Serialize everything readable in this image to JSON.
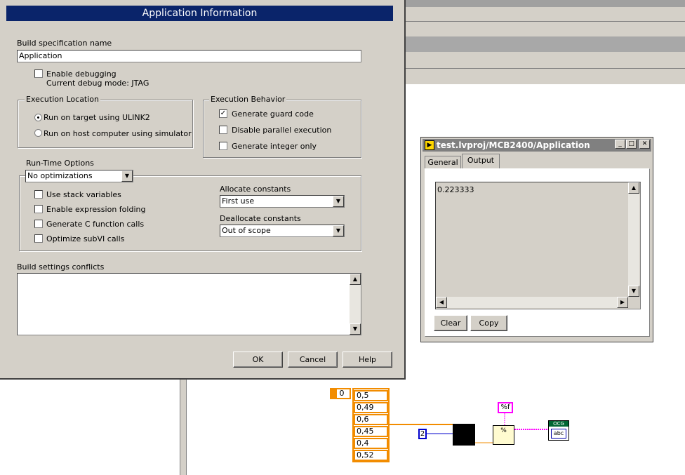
{
  "dialog": {
    "title": "Application Information",
    "build_spec_label": "Build specification name",
    "build_spec_value": "Application",
    "enable_debugging_label": "Enable debugging",
    "debug_mode_text": "Current debug mode: JTAG",
    "execution_location": {
      "title": "Execution Location",
      "options": [
        "Run on target using ULINK2",
        "Run on host computer using simulator"
      ],
      "selected": 0
    },
    "execution_behavior": {
      "title": "Execution Behavior",
      "options": [
        {
          "label": "Generate guard code",
          "checked": true
        },
        {
          "label": "Disable parallel execution",
          "checked": false
        },
        {
          "label": "Generate integer only",
          "checked": false
        }
      ]
    },
    "runtime_options": {
      "title": "Run-Time Options",
      "optimization_value": "No optimizations",
      "checkboxes": [
        {
          "label": "Use stack variables",
          "checked": false
        },
        {
          "label": "Enable expression folding",
          "checked": false
        },
        {
          "label": "Generate C function calls",
          "checked": false
        },
        {
          "label": "Optimize subVI calls",
          "checked": false
        }
      ],
      "allocate_label": "Allocate constants",
      "allocate_value": "First use",
      "deallocate_label": "Deallocate constants",
      "deallocate_value": "Out of scope"
    },
    "conflicts_label": "Build settings conflicts",
    "buttons": {
      "ok": "OK",
      "cancel": "Cancel",
      "help": "Help"
    }
  },
  "output_window": {
    "title": "test.lvproj/MCB2400/Application",
    "tabs": [
      "General",
      "Output"
    ],
    "active_tab": 1,
    "output_text": "0.223333",
    "clear_label": "Clear",
    "copy_label": "Copy"
  },
  "diagram": {
    "index_value": "0",
    "array_values": [
      "0,5",
      "0,49",
      "0,6",
      "0,45",
      "0,4",
      "0,52"
    ],
    "constant_value": "2",
    "format_string": "%f",
    "format_node_text": "%",
    "output_icon_text": "abc",
    "output_icon_header": "OCG"
  },
  "colors": {
    "title_active": "#0a246a",
    "title_inactive": "#808080",
    "dialog_bg": "#d4d0c8",
    "wire_double": "#f28c00",
    "wire_string": "#ff00ff",
    "wire_int": "#0000cc"
  }
}
